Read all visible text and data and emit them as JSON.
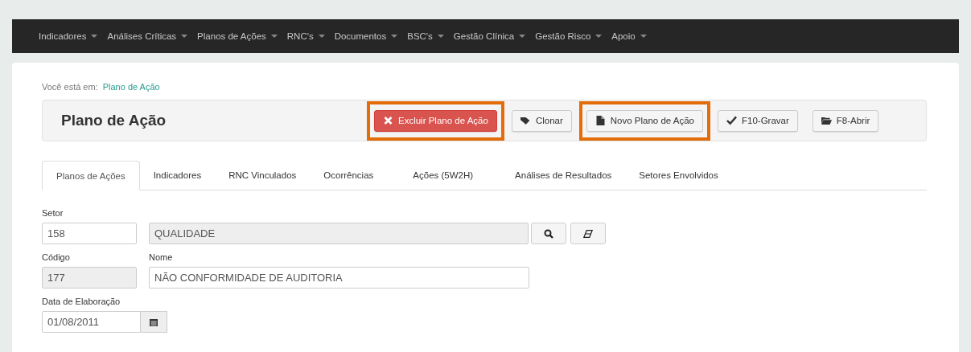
{
  "navbar": [
    {
      "label": "Indicadores"
    },
    {
      "label": "Análises Críticas"
    },
    {
      "label": "Planos de Ações"
    },
    {
      "label": "RNC's"
    },
    {
      "label": "Documentos"
    },
    {
      "label": "BSC's"
    },
    {
      "label": "Gestão Clínica"
    },
    {
      "label": "Gestão Risco"
    },
    {
      "label": "Apoio"
    }
  ],
  "breadcrumb": {
    "prefix": "Você está em:",
    "link": "Plano de Ação"
  },
  "header": {
    "title": "Plano de Ação",
    "buttons": [
      {
        "label": "Excluir Plano de Ação",
        "kind": "delete",
        "highlighted": true
      },
      {
        "label": "Clonar",
        "kind": "clone",
        "highlighted": false
      },
      {
        "label": "Novo Plano de Ação",
        "kind": "new",
        "highlighted": true
      },
      {
        "label": "F10-Gravar",
        "kind": "save",
        "highlighted": false
      },
      {
        "label": "F8-Abrir",
        "kind": "open",
        "highlighted": false
      }
    ]
  },
  "tabs": [
    {
      "label": "Planos de Ações",
      "selected": true
    },
    {
      "label": "Indicadores",
      "selected": false
    },
    {
      "label": "RNC Vinculados",
      "selected": false
    },
    {
      "label": "Ocorrências",
      "selected": false
    },
    {
      "label": "Ações (5W2H)",
      "selected": false
    },
    {
      "label": "Análises de Resultados",
      "selected": false
    },
    {
      "label": "Setores Envolvidos",
      "selected": false
    }
  ],
  "form": {
    "setor": {
      "label": "Setor",
      "code": "158",
      "code_readonly": false,
      "name": "QUALIDADE",
      "name_readonly": true
    },
    "codigo": {
      "label": "Código",
      "value": "177",
      "readonly": true
    },
    "nome": {
      "label": "Nome",
      "value": "NÃO CONFORMIDADE DE AUDITORIA",
      "readonly": false
    },
    "data": {
      "label": "Data de Elaboração",
      "value": "01/08/2011"
    }
  }
}
